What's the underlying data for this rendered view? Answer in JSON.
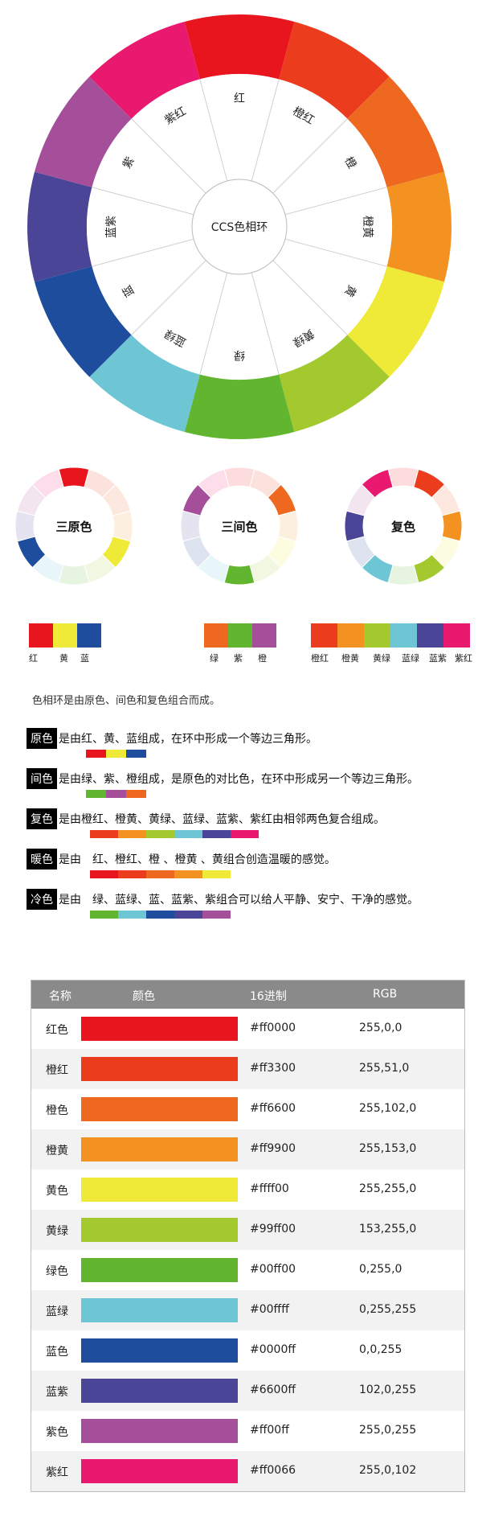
{
  "wheel": {
    "center_label": "CCS色相环",
    "segments": [
      {
        "label": "红",
        "color": "#e8141e"
      },
      {
        "label": "橙红",
        "color": "#eb3d1e"
      },
      {
        "label": "橙",
        "color": "#ee6820"
      },
      {
        "label": "橙黄",
        "color": "#f39221"
      },
      {
        "label": "黄",
        "color": "#eeea37"
      },
      {
        "label": "黄绿",
        "color": "#a3c92f"
      },
      {
        "label": "绿",
        "color": "#62b62f"
      },
      {
        "label": "蓝绿",
        "color": "#6ec6d4"
      },
      {
        "label": "蓝",
        "color": "#1e4d9e"
      },
      {
        "label": "蓝紫",
        "color": "#4a4596"
      },
      {
        "label": "紫",
        "color": "#a54f9b"
      },
      {
        "label": "紫红",
        "color": "#e8196e"
      }
    ]
  },
  "mini_wheels": [
    {
      "label": "三原色",
      "active": [
        0,
        4,
        8
      ]
    },
    {
      "label": "三间色",
      "active": [
        2,
        6,
        10
      ]
    },
    {
      "label": "复色",
      "active": [
        1,
        3,
        5,
        7,
        9,
        11
      ]
    }
  ],
  "swatch_groups": [
    {
      "labels": [
        "红",
        "黄",
        "蓝"
      ],
      "colors": [
        "#e8141e",
        "#eeea37",
        "#1e4d9e"
      ]
    },
    {
      "labels": [
        "绿",
        "紫",
        "橙"
      ],
      "colors": [
        "#ee6820",
        "#62b62f",
        "#a54f9b"
      ]
    },
    {
      "labels": [
        "橙红",
        "橙黄",
        "黄绿",
        "蓝绿",
        "蓝紫",
        "紫红"
      ],
      "colors": [
        "#eb3d1e",
        "#f39221",
        "#a3c92f",
        "#6ec6d4",
        "#4a4596",
        "#e8196e"
      ]
    }
  ],
  "intro": "色相环是由原色、间色和复色组合而成。",
  "definitions": [
    {
      "tag": "原色",
      "text": "是由红、黄、蓝组成，在环中形成一个等边三角形。",
      "bar": [
        "#e8141e",
        "#eeea37",
        "#1e4d9e"
      ]
    },
    {
      "tag": "间色",
      "text": "是由绿、紫、橙组成，是原色的对比色，在环中形成另一个等边三角形。",
      "bar": [
        "#62b62f",
        "#a54f9b",
        "#ee6820"
      ]
    },
    {
      "tag": "复色",
      "text": "是由橙红、橙黄、黄绿、蓝绿、蓝紫、紫红由相邻两色复合组成。",
      "bar": [
        "#eb3d1e",
        "#f39221",
        "#a3c92f",
        "#6ec6d4",
        "#4a4596",
        "#e8196e"
      ]
    },
    {
      "tag": "暖色",
      "text": "是由　红、橙红、橙 、橙黄 、黄组合创造温暖的感觉。",
      "bar": [
        "#e8141e",
        "#eb3d1e",
        "#ee6820",
        "#f39221",
        "#eeea37"
      ]
    },
    {
      "tag": "冷色",
      "text": "是由　绿、蓝绿、蓝、蓝紫、紫组合可以给人平静、安宁、干净的感觉。",
      "bar": [
        "#62b62f",
        "#6ec6d4",
        "#1e4d9e",
        "#4a4596",
        "#a54f9b"
      ]
    }
  ],
  "table": {
    "headers": [
      "名称",
      "颜色",
      "16进制",
      "RGB"
    ],
    "rows": [
      {
        "name": "红色",
        "hex": "#ff0000",
        "rgb": "255,0,0",
        "color": "#e8141e"
      },
      {
        "name": "橙红",
        "hex": "#ff3300",
        "rgb": "255,51,0",
        "color": "#eb3d1e"
      },
      {
        "name": "橙色",
        "hex": "#ff6600",
        "rgb": "255,102,0",
        "color": "#ee6820"
      },
      {
        "name": "橙黄",
        "hex": "#ff9900",
        "rgb": "255,153,0",
        "color": "#f39221"
      },
      {
        "name": "黄色",
        "hex": "#ffff00",
        "rgb": "255,255,0",
        "color": "#eeea37"
      },
      {
        "name": "黄绿",
        "hex": "#99ff00",
        "rgb": "153,255,0",
        "color": "#a3c92f"
      },
      {
        "name": "绿色",
        "hex": "#00ff00",
        "rgb": "0,255,0",
        "color": "#62b62f"
      },
      {
        "name": "蓝绿",
        "hex": "#00ffff",
        "rgb": "0,255,255",
        "color": "#6ec6d4"
      },
      {
        "name": "蓝色",
        "hex": "#0000ff",
        "rgb": "0,0,255",
        "color": "#1e4d9e"
      },
      {
        "name": "蓝紫",
        "hex": "#6600ff",
        "rgb": "102,0,255",
        "color": "#4a4596"
      },
      {
        "name": "紫色",
        "hex": "#ff00ff",
        "rgb": "255,0,255",
        "color": "#a54f9b"
      },
      {
        "name": "紫红",
        "hex": "#ff0066",
        "rgb": "255,0,102",
        "color": "#e8196e"
      }
    ]
  }
}
